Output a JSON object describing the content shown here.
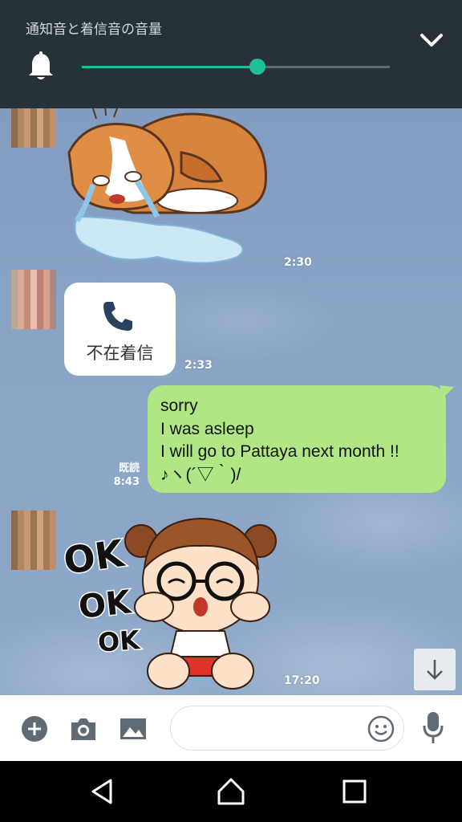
{
  "volume": {
    "title": "通知音と着信音の音量",
    "level_percent": 57
  },
  "messages": [
    {
      "type": "sticker",
      "sticker": "crying-corgi",
      "time": "2:30"
    },
    {
      "type": "missed-call",
      "label": "不在着信",
      "time": "2:33"
    },
    {
      "type": "sent",
      "lines": [
        "sorry",
        "I was asleep",
        "I will go to Pattaya next month !!",
        "♪ヽ(´▽｀)/"
      ],
      "read_label": "既読",
      "time": "8:43"
    },
    {
      "type": "sticker",
      "sticker": "ok-ok-ok-girl",
      "sticker_text": [
        "OK",
        "OK",
        "OK"
      ],
      "time": "17:20"
    }
  ],
  "input": {
    "value": "",
    "placeholder": ""
  },
  "icons": {
    "volume_collapse": "chevron-down-icon",
    "bell": "bell-icon",
    "scroll_down": "arrow-down-icon",
    "add": "plus-icon",
    "camera": "camera-icon",
    "gallery": "image-icon",
    "emoji": "smiley-icon",
    "voice": "mic-icon",
    "nav_back": "back-triangle-icon",
    "nav_home": "home-icon",
    "nav_recents": "recents-square-icon"
  },
  "colors": {
    "volume_accent": "#1fbf9a",
    "panel_bg": "#263238",
    "sent_bubble": "#b1e684",
    "chat_bg": "#7f9bbf"
  }
}
